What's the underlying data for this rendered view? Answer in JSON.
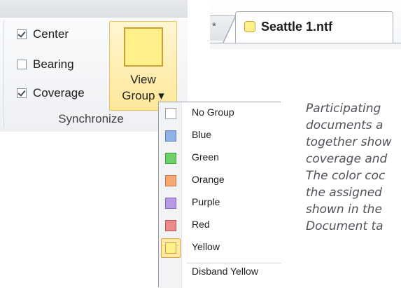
{
  "ribbon": {
    "checkboxes": [
      {
        "label": "Center",
        "checked": true
      },
      {
        "label": "Bearing",
        "checked": false
      },
      {
        "label": "Coverage",
        "checked": true
      }
    ],
    "view_group_button": {
      "line1": "View",
      "line2": "Group ▾",
      "swatch_color": "#fff08a",
      "swatch_border": "#c9a132"
    },
    "group_caption": "Synchronize"
  },
  "tabs": {
    "previous_tab_glyph": "*",
    "active_tab": {
      "title": "Seattle 1.ntf",
      "group_color": "#fff08a"
    }
  },
  "menu": {
    "items": [
      {
        "label": "No Group",
        "fill": "#ffffff",
        "border": "#9aa0a8",
        "selected": false
      },
      {
        "label": "Blue",
        "fill": "#8fb2e6",
        "border": "#5b7fb8",
        "selected": false
      },
      {
        "label": "Green",
        "fill": "#6fd06b",
        "border": "#3f9e3b",
        "selected": false
      },
      {
        "label": "Orange",
        "fill": "#f6a874",
        "border": "#c77a46",
        "selected": false
      },
      {
        "label": "Purple",
        "fill": "#b79ae6",
        "border": "#8466b8",
        "selected": false
      },
      {
        "label": "Red",
        "fill": "#eb8b8b",
        "border": "#b85656",
        "selected": false
      },
      {
        "label": "Yellow",
        "fill": "#fff08a",
        "border": "#c9a132",
        "selected": true
      }
    ],
    "disband_label": "Disband Yellow"
  },
  "caption_lines": [
    "Participating",
    "documents a",
    "together show",
    "coverage and",
    "The color coc",
    "the assigned",
    "shown in the",
    "Document ta"
  ]
}
